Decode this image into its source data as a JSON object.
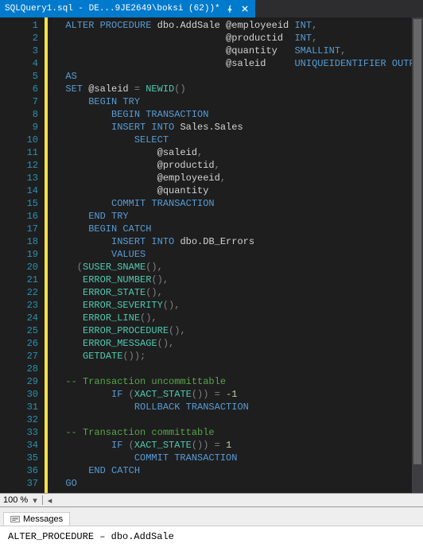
{
  "tab": {
    "title": "SQLQuery1.sql - DE...9JE2649\\boksi (62))*"
  },
  "zoom": {
    "level": "100 %"
  },
  "messages": {
    "tab_label": "Messages",
    "content": "ALTER_PROCEDURE – dbo.AddSale"
  },
  "code": {
    "lines": [
      {
        "n": 1,
        "t": [
          {
            "c": "kw",
            "s": "  ALTER PROCEDURE "
          },
          {
            "c": "id",
            "s": "dbo"
          },
          {
            "c": "pn",
            "s": "."
          },
          {
            "c": "id",
            "s": "AddSale "
          },
          {
            "c": "var",
            "s": "@employeeid "
          },
          {
            "c": "type",
            "s": "INT"
          },
          {
            "c": "gray",
            "s": ","
          }
        ]
      },
      {
        "n": 2,
        "t": [
          {
            "c": "id",
            "s": "                              "
          },
          {
            "c": "var",
            "s": "@productid  "
          },
          {
            "c": "type",
            "s": "INT"
          },
          {
            "c": "gray",
            "s": ","
          }
        ]
      },
      {
        "n": 3,
        "t": [
          {
            "c": "id",
            "s": "                              "
          },
          {
            "c": "var",
            "s": "@quantity   "
          },
          {
            "c": "type",
            "s": "SMALLINT"
          },
          {
            "c": "gray",
            "s": ","
          }
        ]
      },
      {
        "n": 4,
        "t": [
          {
            "c": "id",
            "s": "                              "
          },
          {
            "c": "var",
            "s": "@saleid     "
          },
          {
            "c": "type",
            "s": "UNIQUEIDENTIFIER OUTPUT"
          }
        ]
      },
      {
        "n": 5,
        "t": [
          {
            "c": "kw",
            "s": "  AS"
          }
        ]
      },
      {
        "n": 6,
        "t": [
          {
            "c": "kw",
            "s": "  SET "
          },
          {
            "c": "var",
            "s": "@saleid "
          },
          {
            "c": "gray",
            "s": "= "
          },
          {
            "c": "fn",
            "s": "NEWID"
          },
          {
            "c": "gray",
            "s": "()"
          }
        ]
      },
      {
        "n": 7,
        "t": [
          {
            "c": "kw",
            "s": "      BEGIN TRY"
          }
        ]
      },
      {
        "n": 8,
        "t": [
          {
            "c": "kw",
            "s": "          BEGIN TRANSACTION"
          }
        ]
      },
      {
        "n": 9,
        "t": [
          {
            "c": "kw",
            "s": "          INSERT INTO "
          },
          {
            "c": "id",
            "s": "Sales"
          },
          {
            "c": "pn",
            "s": "."
          },
          {
            "c": "id",
            "s": "Sales"
          }
        ]
      },
      {
        "n": 10,
        "t": [
          {
            "c": "kw",
            "s": "              SELECT"
          }
        ]
      },
      {
        "n": 11,
        "t": [
          {
            "c": "id",
            "s": "                  "
          },
          {
            "c": "var",
            "s": "@saleid"
          },
          {
            "c": "gray",
            "s": ","
          }
        ]
      },
      {
        "n": 12,
        "t": [
          {
            "c": "id",
            "s": "                  "
          },
          {
            "c": "var",
            "s": "@productid"
          },
          {
            "c": "gray",
            "s": ","
          }
        ]
      },
      {
        "n": 13,
        "t": [
          {
            "c": "id",
            "s": "                  "
          },
          {
            "c": "var",
            "s": "@employeeid"
          },
          {
            "c": "gray",
            "s": ","
          }
        ]
      },
      {
        "n": 14,
        "t": [
          {
            "c": "id",
            "s": "                  "
          },
          {
            "c": "var",
            "s": "@quantity"
          }
        ]
      },
      {
        "n": 15,
        "t": [
          {
            "c": "kw",
            "s": "          COMMIT TRANSACTION"
          }
        ]
      },
      {
        "n": 16,
        "t": [
          {
            "c": "kw",
            "s": "      END TRY"
          }
        ]
      },
      {
        "n": 17,
        "t": [
          {
            "c": "kw",
            "s": "      BEGIN CATCH"
          }
        ]
      },
      {
        "n": 18,
        "t": [
          {
            "c": "kw",
            "s": "          INSERT INTO "
          },
          {
            "c": "id",
            "s": "dbo"
          },
          {
            "c": "pn",
            "s": "."
          },
          {
            "c": "id",
            "s": "DB_Errors"
          }
        ]
      },
      {
        "n": 19,
        "t": [
          {
            "c": "kw",
            "s": "          VALUES"
          }
        ]
      },
      {
        "n": 20,
        "t": [
          {
            "c": "gray",
            "s": "    ("
          },
          {
            "c": "fn",
            "s": "SUSER_SNAME"
          },
          {
            "c": "gray",
            "s": "(),"
          }
        ]
      },
      {
        "n": 21,
        "t": [
          {
            "c": "id",
            "s": "     "
          },
          {
            "c": "fn",
            "s": "ERROR_NUMBER"
          },
          {
            "c": "gray",
            "s": "(),"
          }
        ]
      },
      {
        "n": 22,
        "t": [
          {
            "c": "id",
            "s": "     "
          },
          {
            "c": "fn",
            "s": "ERROR_STATE"
          },
          {
            "c": "gray",
            "s": "(),"
          }
        ]
      },
      {
        "n": 23,
        "t": [
          {
            "c": "id",
            "s": "     "
          },
          {
            "c": "fn",
            "s": "ERROR_SEVERITY"
          },
          {
            "c": "gray",
            "s": "(),"
          }
        ]
      },
      {
        "n": 24,
        "t": [
          {
            "c": "id",
            "s": "     "
          },
          {
            "c": "fn",
            "s": "ERROR_LINE"
          },
          {
            "c": "gray",
            "s": "(),"
          }
        ]
      },
      {
        "n": 25,
        "t": [
          {
            "c": "id",
            "s": "     "
          },
          {
            "c": "fn",
            "s": "ERROR_PROCEDURE"
          },
          {
            "c": "gray",
            "s": "(),"
          }
        ]
      },
      {
        "n": 26,
        "t": [
          {
            "c": "id",
            "s": "     "
          },
          {
            "c": "fn",
            "s": "ERROR_MESSAGE"
          },
          {
            "c": "gray",
            "s": "(),"
          }
        ]
      },
      {
        "n": 27,
        "t": [
          {
            "c": "id",
            "s": "     "
          },
          {
            "c": "fn",
            "s": "GETDATE"
          },
          {
            "c": "gray",
            "s": "());"
          }
        ]
      },
      {
        "n": 28,
        "t": [
          {
            "c": "id",
            "s": ""
          }
        ]
      },
      {
        "n": 29,
        "t": [
          {
            "c": "cmt",
            "s": "  -- Transaction uncommittable"
          }
        ]
      },
      {
        "n": 30,
        "t": [
          {
            "c": "kw",
            "s": "          IF "
          },
          {
            "c": "gray",
            "s": "("
          },
          {
            "c": "fn",
            "s": "XACT_STATE"
          },
          {
            "c": "gray",
            "s": "()) = "
          },
          {
            "c": "num",
            "s": "-1"
          }
        ]
      },
      {
        "n": 31,
        "t": [
          {
            "c": "kw",
            "s": "              ROLLBACK TRANSACTION"
          }
        ]
      },
      {
        "n": 32,
        "t": [
          {
            "c": "id",
            "s": ""
          }
        ]
      },
      {
        "n": 33,
        "t": [
          {
            "c": "cmt",
            "s": "  -- Transaction committable"
          }
        ]
      },
      {
        "n": 34,
        "t": [
          {
            "c": "kw",
            "s": "          IF "
          },
          {
            "c": "gray",
            "s": "("
          },
          {
            "c": "fn",
            "s": "XACT_STATE"
          },
          {
            "c": "gray",
            "s": "()) = "
          },
          {
            "c": "num",
            "s": "1"
          }
        ]
      },
      {
        "n": 35,
        "t": [
          {
            "c": "kw",
            "s": "              COMMIT TRANSACTION"
          }
        ]
      },
      {
        "n": 36,
        "t": [
          {
            "c": "kw",
            "s": "      END CATCH"
          }
        ]
      },
      {
        "n": 37,
        "t": [
          {
            "c": "kw",
            "s": "  GO"
          }
        ]
      }
    ]
  }
}
